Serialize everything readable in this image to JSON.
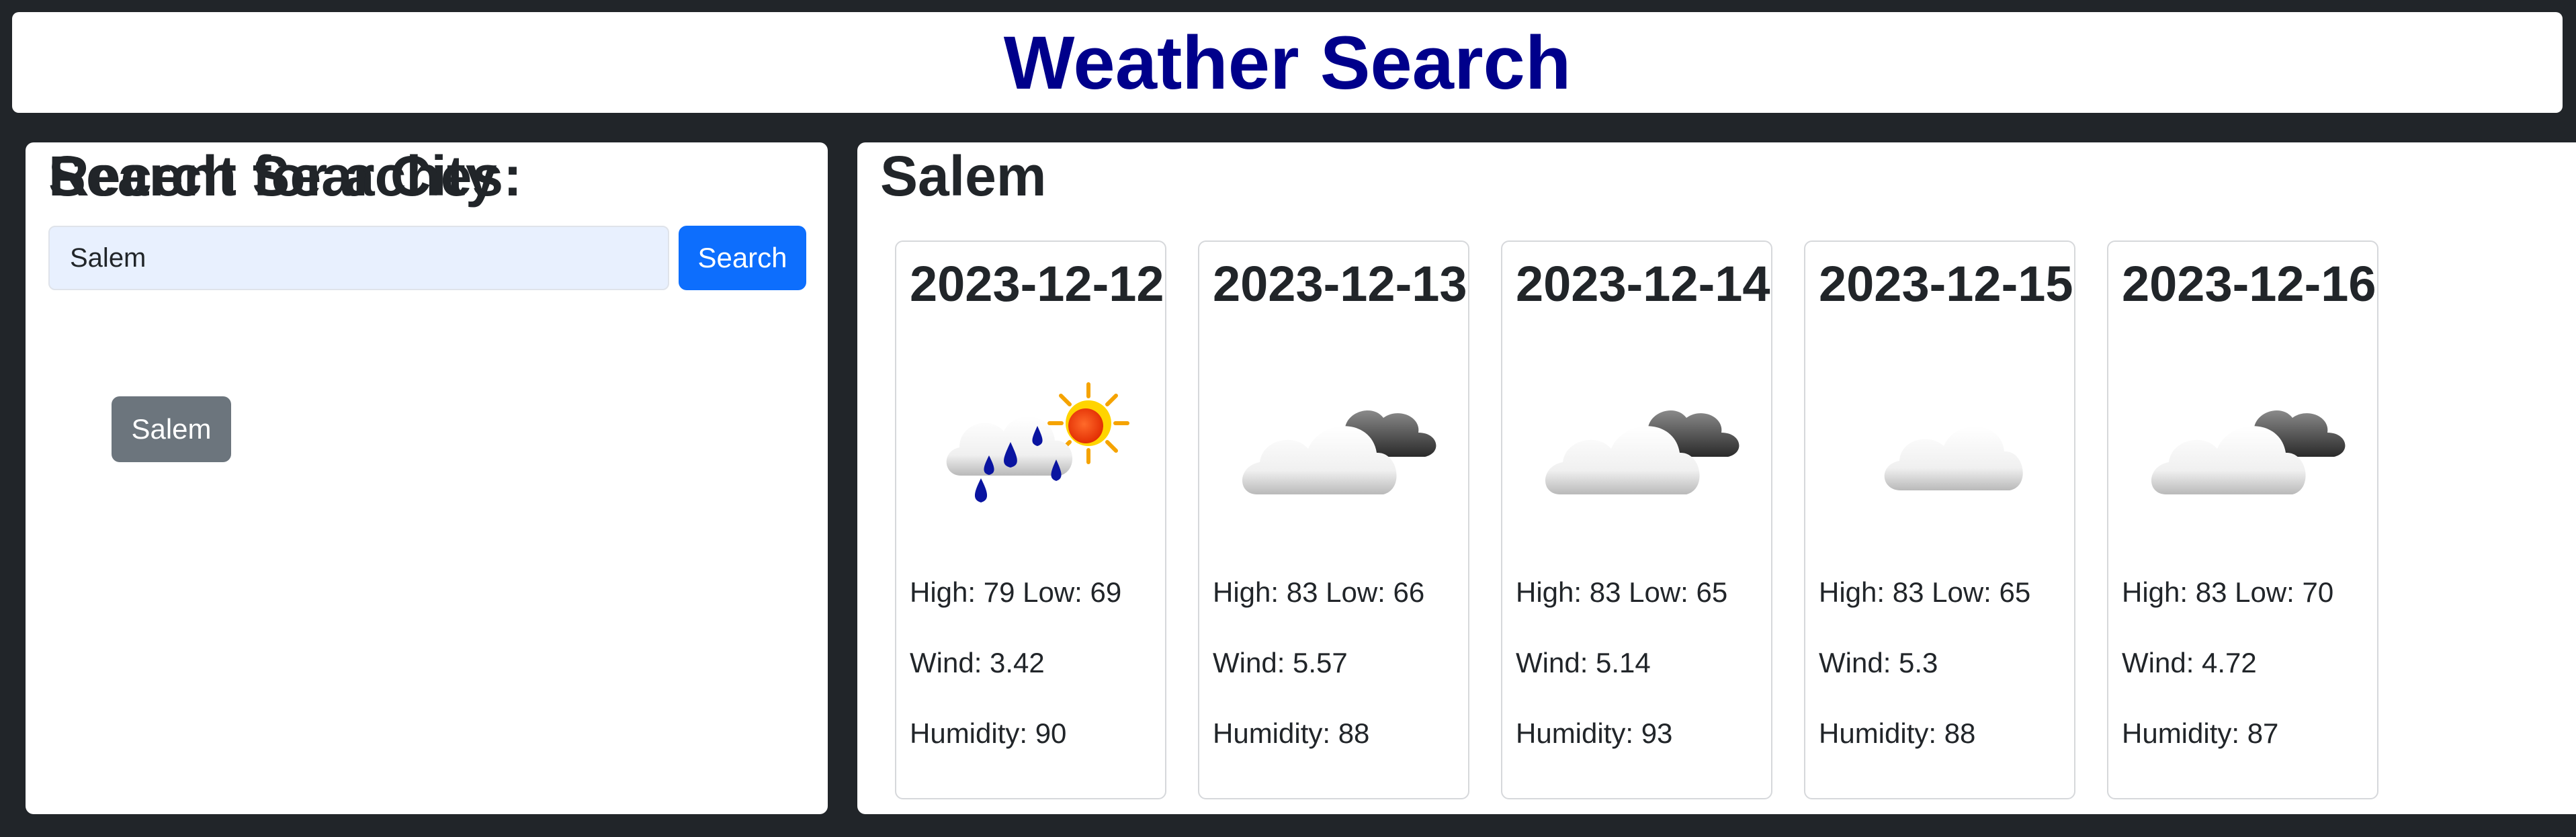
{
  "header": {
    "title": "Weather Search"
  },
  "sidebar": {
    "heading": "Search for a City",
    "search_value": "Salem",
    "search_button": "Search",
    "recent_heading": "Recent Searches:",
    "recent": [
      "Salem"
    ]
  },
  "main": {
    "city": "Salem",
    "forecast": [
      {
        "date": "2023-12-12",
        "icon": "rain-sun-icon",
        "temps": "High: 79 Low: 69",
        "wind": "Wind: 3.42",
        "humidity": "Humidity: 90"
      },
      {
        "date": "2023-12-13",
        "icon": "cloudy-icon",
        "temps": "High: 83 Low: 66",
        "wind": "Wind: 5.57",
        "humidity": "Humidity: 88"
      },
      {
        "date": "2023-12-14",
        "icon": "cloudy-icon",
        "temps": "High: 83 Low: 65",
        "wind": "Wind: 5.14",
        "humidity": "Humidity: 93"
      },
      {
        "date": "2023-12-15",
        "icon": "cloud-icon",
        "temps": "High: 83 Low: 65",
        "wind": "Wind: 5.3",
        "humidity": "Humidity: 88"
      },
      {
        "date": "2023-12-16",
        "icon": "cloudy-icon",
        "temps": "High: 83 Low: 70",
        "wind": "Wind: 4.72",
        "humidity": "Humidity: 87"
      }
    ]
  },
  "colors": {
    "page_bg": "#212529",
    "title": "#00008b",
    "primary": "#0d6efd",
    "secondary": "#6c757d",
    "input_bg": "#e8f0fe"
  }
}
